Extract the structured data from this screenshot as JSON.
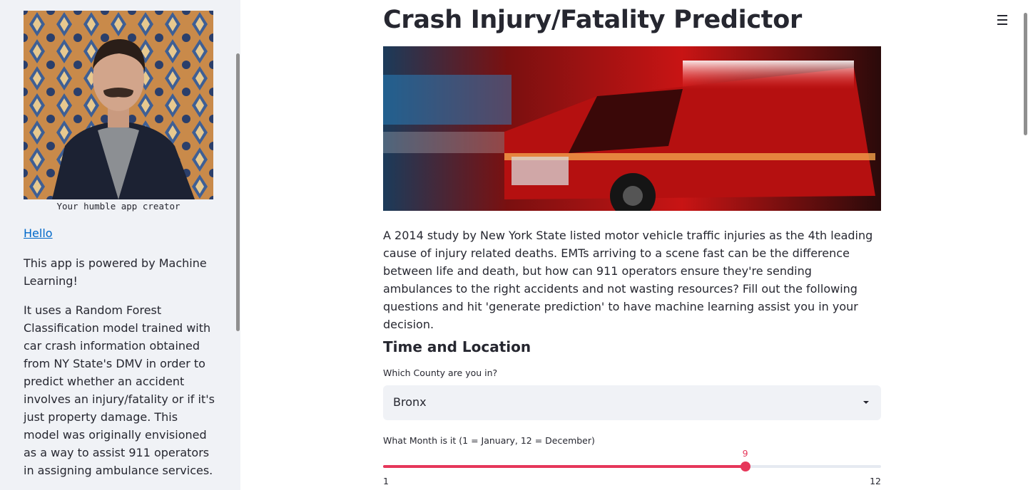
{
  "sidebar": {
    "photo_caption": "Your humble app creator",
    "link_label": "Hello",
    "paragraphs": [
      "This app is powered by Machine Learning!",
      "It uses a Random Forest Classification model trained with car crash information obtained from NY State's DMV in order to predict whether an accident involves an injury/fatality or if it's just property damage. This model was originally envisioned as a way to assist 911 operators in assigning ambulance services."
    ]
  },
  "main": {
    "title": "Crash Injury/Fatality Predictor",
    "intro": "A 2014 study by New York State listed motor vehicle traffic injuries as the 4th leading cause of injury related deaths. EMTs arriving to a scene fast can be the difference between life and death, but how can 911 operators ensure they're sending ambulances to the right accidents and not wasting resources? Fill out the following questions and hit 'generate prediction' to have machine learning assist you in your decision.",
    "section_title": "Time and Location",
    "county": {
      "label": "Which County are you in?",
      "value": "Bronx"
    },
    "month": {
      "label": "What Month is it (1 = January, 12 = December)",
      "value": "9",
      "min": "1",
      "max": "12"
    }
  },
  "colors": {
    "accent": "#e6375a",
    "sidebar_bg": "#f0f2f6",
    "link": "#0068c9",
    "text": "#262730"
  },
  "icons": [
    "hamburger-menu-icon",
    "dropdown-caret-icon"
  ]
}
